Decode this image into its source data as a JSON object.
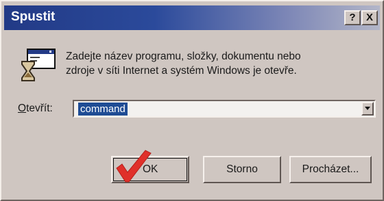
{
  "window": {
    "title": "Spustit",
    "help_button": "?",
    "close_button": "X"
  },
  "description": {
    "line1": "Zadejte název programu, složky, dokumentu nebo",
    "line2": "zdroje v síti Internet a systém Windows je otevře."
  },
  "open_field": {
    "label_accel": "O",
    "label_rest": "tevřít:",
    "value": "command"
  },
  "buttons": {
    "ok": "OK",
    "cancel": "Storno",
    "browse": "Procházet..."
  },
  "colors": {
    "title_gradient_start": "#223a86",
    "title_gradient_end": "#b3b6c8",
    "selection": "#1f4c94",
    "checkmark": "#e0302a",
    "face": "#cfc6c1"
  },
  "icons": [
    "run-program-icon",
    "checkmark-icon",
    "chevron-down-icon"
  ]
}
